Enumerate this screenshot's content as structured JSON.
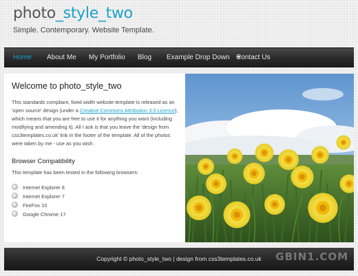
{
  "site": {
    "title_part1": "photo",
    "title_part2": "_style_two",
    "slogan": "Simple. Contemporary. Website Template."
  },
  "menu": {
    "items": [
      {
        "label": "Home",
        "active": true
      },
      {
        "label": "About Me",
        "active": false
      },
      {
        "label": "My Portfolio",
        "active": false
      },
      {
        "label": "Blog",
        "active": false
      },
      {
        "label": "Example Drop Down",
        "active": false,
        "has_dropdown": true
      },
      {
        "label": "Contact Us",
        "active": false
      }
    ]
  },
  "main": {
    "heading": "Welcome to photo_style_two",
    "intro_before_link": "This standards compliant, fixed width website template is released as an 'open source' design (under a ",
    "intro_link": "Creative Commons Attribution 3.0 Licence",
    "intro_after_link": "), which means that you are free to use it for anything you want (including modifying and amending it). All I ask is that you leave the 'design from css3templates.co.uk' link in the footer of the template. All of the photos were taken by me - use as you wish.",
    "subheading": "Browser Compatibility",
    "compat_text": "This template has been tested in the following browsers:",
    "browsers": [
      "Internet Explorer 8",
      "Internet Explorer 7",
      "FireFox 10",
      "Google Chrome 17"
    ]
  },
  "photo": {
    "icon": "daffodils-photo"
  },
  "footer": {
    "text": "Copyright © photo_style_two | design from css3templates.co.uk"
  },
  "watermark": "GBIN1.COM",
  "colors": {
    "accent": "#1aa2c9",
    "menubar": "#2a2a2a",
    "background": "#f2f2f2"
  }
}
